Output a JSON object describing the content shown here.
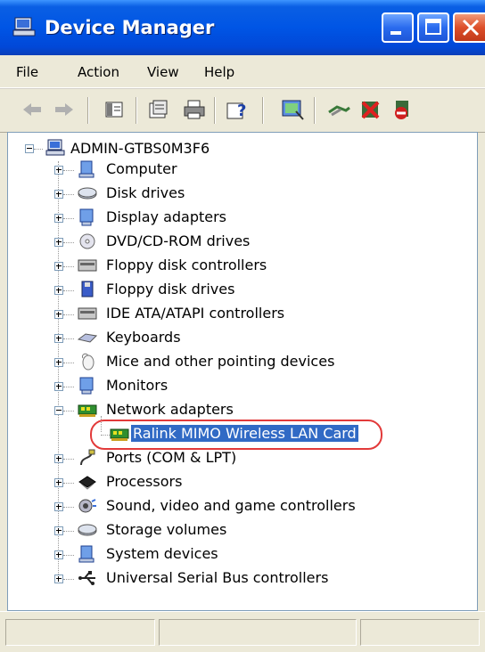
{
  "window": {
    "title": "Device Manager"
  },
  "menu": [
    "File",
    "Action",
    "View",
    "Help"
  ],
  "toolbar": {
    "icons": [
      "back-arrow-icon",
      "forward-arrow-icon",
      "show-hide-tree-icon",
      "properties-icon",
      "print-icon",
      "help-icon",
      "scan-hardware-icon",
      "update-driver-icon",
      "uninstall-icon",
      "disable-device-icon"
    ]
  },
  "tree": {
    "root": "ADMIN-GTBS0M3F6",
    "items": [
      {
        "label": "Computer"
      },
      {
        "label": "Disk drives"
      },
      {
        "label": "Display adapters"
      },
      {
        "label": "DVD/CD-ROM drives"
      },
      {
        "label": "Floppy disk controllers"
      },
      {
        "label": "Floppy disk drives"
      },
      {
        "label": "IDE ATA/ATAPI controllers"
      },
      {
        "label": "Keyboards"
      },
      {
        "label": "Mice and other pointing devices"
      },
      {
        "label": "Monitors"
      },
      {
        "label": "Network adapters"
      },
      {
        "label": "Ralink MIMO Wireless LAN Card"
      },
      {
        "label": "Ports (COM & LPT)"
      },
      {
        "label": "Processors"
      },
      {
        "label": "Sound, video and game controllers"
      },
      {
        "label": "Storage volumes"
      },
      {
        "label": "System devices"
      },
      {
        "label": "Universal Serial Bus controllers"
      }
    ]
  },
  "colors": {
    "title_bar": "#0055e5",
    "selection": "#316ac5",
    "highlight_ring": "#e23a3a"
  }
}
